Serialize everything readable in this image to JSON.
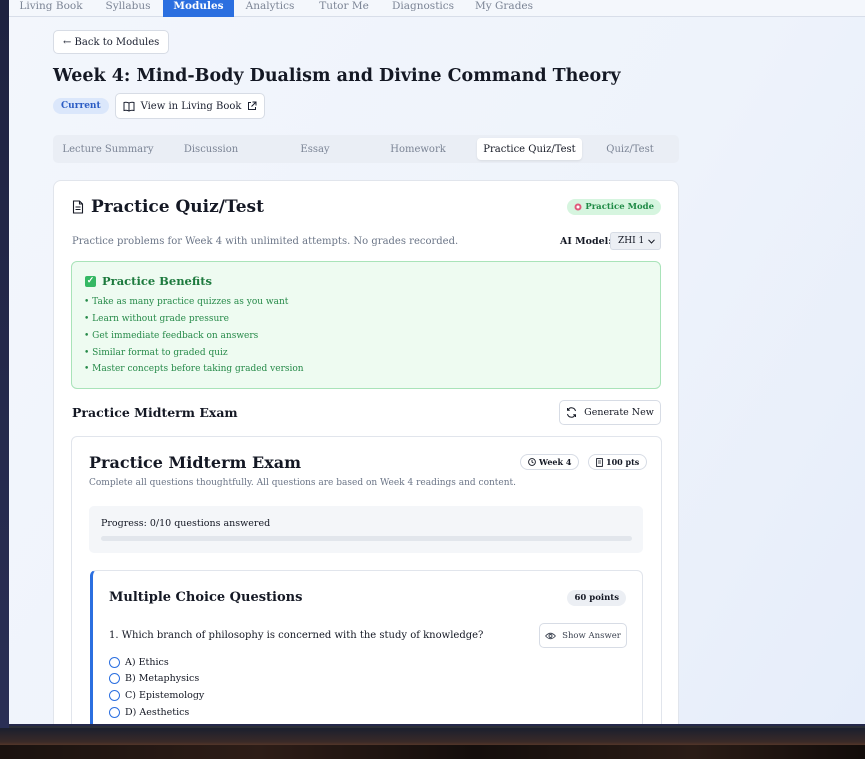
{
  "topnav": {
    "items": [
      {
        "label": "Living Book"
      },
      {
        "label": "Syllabus"
      },
      {
        "label": "Modules"
      },
      {
        "label": "Analytics"
      },
      {
        "label": "Tutor Me"
      },
      {
        "label": "Diagnostics"
      },
      {
        "label": "My Grades"
      }
    ],
    "active": "Modules"
  },
  "back_button": "← Back to Modules",
  "week_title": "Week 4: Mind-Body Dualism and Divine Command Theory",
  "current_badge": "Current",
  "living_book_button": "View in Living Book",
  "tabs": [
    {
      "label": "Lecture Summary"
    },
    {
      "label": "Discussion"
    },
    {
      "label": "Essay"
    },
    {
      "label": "Homework"
    },
    {
      "label": "Practice Quiz/Test"
    },
    {
      "label": "Quiz/Test"
    }
  ],
  "active_tab": "Practice Quiz/Test",
  "practice": {
    "title": "Practice Quiz/Test",
    "mode_badge": "Practice Mode",
    "description": "Practice problems for Week 4 with unlimited attempts. No grades recorded.",
    "ai_model_label": "AI Model:",
    "ai_model_value": "ZHI 1",
    "benefits_title": "Practice Benefits",
    "benefits": [
      "• Take as many practice quizzes as you want",
      "• Learn without grade pressure",
      "• Get immediate feedback on answers",
      "• Similar format to graded quiz",
      "• Master concepts before taking graded version"
    ],
    "exam_heading": "Practice Midterm Exam",
    "generate_button": "Generate New"
  },
  "exam": {
    "title": "Practice Midterm Exam",
    "week_pill": "Week 4",
    "points_pill": "100 pts",
    "description": "Complete all questions thoughtfully. All questions are based on Week 4 readings and content.",
    "progress_text": "Progress: 0/10 questions answered",
    "progress_fraction": 0,
    "section_title": "Multiple Choice Questions",
    "section_points": "60 points",
    "question": "1. Which branch of philosophy is concerned with the study of knowledge?",
    "show_answer": "Show Answer",
    "options": [
      "A) Ethics",
      "B) Metaphysics",
      "C) Epistemology",
      "D) Aesthetics"
    ]
  },
  "colors": {
    "accent": "#2b6fe0",
    "success": "#1f8a45",
    "success_bg": "#eefbf1"
  }
}
